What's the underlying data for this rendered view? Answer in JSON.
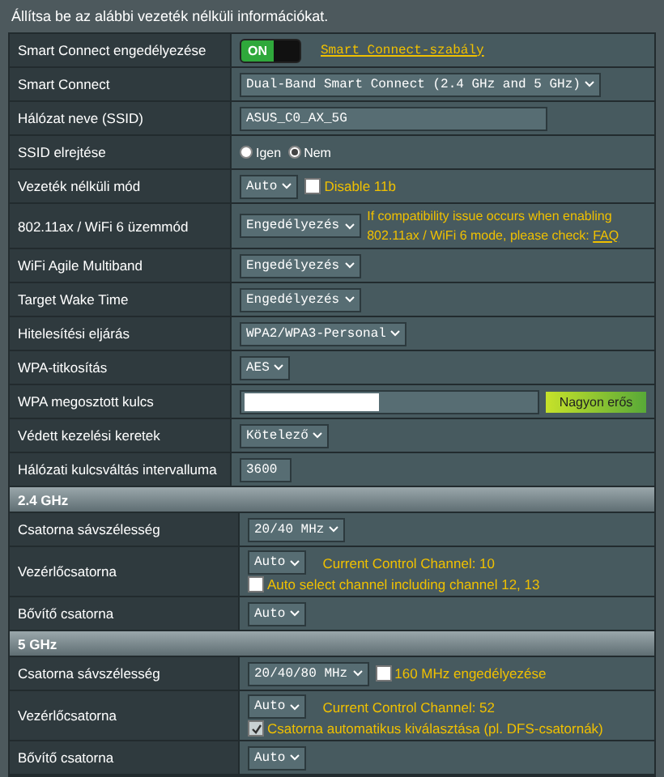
{
  "intro": "Állítsa be az alábbi vezeték nélküli információkat.",
  "rows": [
    {
      "label": "Smart Connect engedélyezése",
      "lines": [
        [
          {
            "kind": "toggle",
            "text": "ON",
            "on": true
          },
          {
            "kind": "link",
            "text": "Smart Connect-szabály"
          }
        ]
      ]
    },
    {
      "label": "Smart Connect",
      "lines": [
        [
          {
            "kind": "select",
            "value": "Dual-Band Smart Connect (2.4 GHz and 5 GHz)"
          }
        ]
      ]
    },
    {
      "label": "Hálózat neve (SSID)",
      "lines": [
        [
          {
            "kind": "input",
            "value": "ASUS_C0_AX_5G"
          }
        ]
      ]
    },
    {
      "label": "SSID elrejtése",
      "lines": [
        [
          {
            "kind": "radio",
            "text": "Igen",
            "selected": false
          },
          {
            "kind": "radio",
            "text": "Nem",
            "selected": true
          }
        ]
      ]
    },
    {
      "label": "Vezeték nélküli mód",
      "lines": [
        [
          {
            "kind": "select",
            "value": "Auto"
          },
          {
            "kind": "checkbox",
            "text": "Disable 11b",
            "checked": false
          }
        ]
      ]
    },
    {
      "label": "802.11ax / WiFi 6 üzemmód",
      "lines": [
        [
          {
            "kind": "select",
            "value": "Engedélyezés"
          },
          {
            "kind": "note",
            "text": "If compatibility issue occurs when enabling 802.11ax / WiFi 6 mode, please check: ",
            "link": "FAQ"
          }
        ]
      ]
    },
    {
      "label": "WiFi Agile Multiband",
      "lines": [
        [
          {
            "kind": "select",
            "value": "Engedélyezés"
          }
        ]
      ]
    },
    {
      "label": "Target Wake Time",
      "lines": [
        [
          {
            "kind": "select",
            "value": "Engedélyezés"
          }
        ]
      ]
    },
    {
      "label": "Hitelesítési eljárás",
      "lines": [
        [
          {
            "kind": "select",
            "value": "WPA2/WPA3-Personal"
          }
        ]
      ]
    },
    {
      "label": "WPA-titkosítás",
      "lines": [
        [
          {
            "kind": "select",
            "value": "AES"
          }
        ]
      ]
    },
    {
      "label": "WPA megosztott kulcs",
      "lines": [
        [
          {
            "kind": "password"
          },
          {
            "kind": "strength",
            "text": "Nagyon erős"
          }
        ]
      ]
    },
    {
      "label": "Védett kezelési keretek",
      "lines": [
        [
          {
            "kind": "select",
            "value": "Kötelező"
          }
        ]
      ]
    },
    {
      "label": "Hálózati kulcsváltás intervalluma",
      "lines": [
        [
          {
            "kind": "input",
            "value": "3600",
            "short": true
          }
        ]
      ]
    }
  ],
  "sections": [
    {
      "title": "2.4 GHz",
      "rows": [
        {
          "label": "Csatorna sávszélesség",
          "lines": [
            [
              {
                "kind": "select",
                "value": "20/40 MHz"
              }
            ]
          ]
        },
        {
          "label": "Vezérlőcsatorna",
          "lines": [
            [
              {
                "kind": "select",
                "value": "Auto"
              },
              {
                "kind": "info",
                "text": "Current Control Channel: 10"
              }
            ],
            [
              {
                "kind": "checkbox",
                "text": "Auto select channel including channel 12, 13",
                "checked": false
              }
            ]
          ]
        },
        {
          "label": "Bővítő csatorna",
          "lines": [
            [
              {
                "kind": "select",
                "value": "Auto"
              }
            ]
          ]
        }
      ]
    },
    {
      "title": "5 GHz",
      "rows": [
        {
          "label": "Csatorna sávszélesség",
          "lines": [
            [
              {
                "kind": "select",
                "value": "20/40/80 MHz"
              },
              {
                "kind": "checkbox",
                "text": "160 MHz engedélyezése",
                "checked": false
              }
            ]
          ]
        },
        {
          "label": "Vezérlőcsatorna",
          "lines": [
            [
              {
                "kind": "select",
                "value": "Auto"
              },
              {
                "kind": "info",
                "text": "Current Control Channel: 52"
              }
            ],
            [
              {
                "kind": "checkbox",
                "text": "Csatorna automatikus kiválasztása (pl. DFS-csatornák)",
                "checked": true
              }
            ]
          ]
        },
        {
          "label": "Bővítő csatorna",
          "lines": [
            [
              {
                "kind": "select",
                "value": "Auto"
              }
            ]
          ]
        }
      ]
    }
  ]
}
